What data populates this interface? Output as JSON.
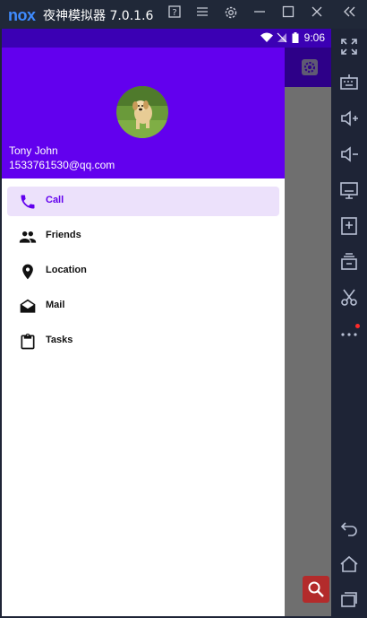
{
  "emulator": {
    "logo": "nox",
    "title": "夜神模拟器 7.0.1.6"
  },
  "status_bar": {
    "time": "9:06"
  },
  "drawer": {
    "user_name": "Tony John",
    "user_email": "1533761530@qq.com",
    "items": [
      {
        "label": "Call",
        "icon": "phone-icon",
        "selected": true
      },
      {
        "label": "Friends",
        "icon": "people-icon",
        "selected": false
      },
      {
        "label": "Location",
        "icon": "location-pin-icon",
        "selected": false
      },
      {
        "label": "Mail",
        "icon": "mail-open-icon",
        "selected": false
      },
      {
        "label": "Tasks",
        "icon": "clipboard-icon",
        "selected": false
      }
    ]
  },
  "colors": {
    "primary": "#6200ee",
    "primary_dark": "#3b00b4",
    "selected_bg": "#ece1fb",
    "fab": "#b32b2b"
  }
}
